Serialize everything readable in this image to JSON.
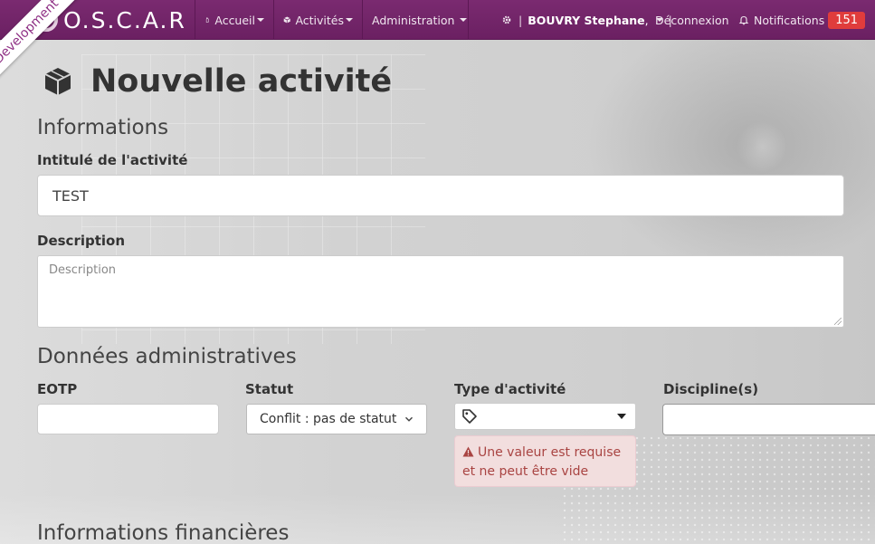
{
  "ribbon": {
    "text": "Development"
  },
  "navbar": {
    "brand": "O.S.C.A.R",
    "menus": [
      {
        "label": "Accueil",
        "icon": "hand-icon"
      },
      {
        "label": "Activités",
        "icon": "cube-icon"
      },
      {
        "label": "Administration",
        "icon": ""
      }
    ],
    "user": {
      "name": "BOUVRY Stephane",
      "suffix": ","
    },
    "logout": "Déconnexion",
    "notifications": {
      "label": "Notifications",
      "count": "151"
    },
    "colors": {
      "bar": "#6b2062",
      "badge": "#e03c3c"
    }
  },
  "page": {
    "title": "Nouvelle activité",
    "title_icon": "cube-icon"
  },
  "informations": {
    "heading": "Informations",
    "intitule_label": "Intitulé de l'activité",
    "intitule_value": "TEST",
    "description_label": "Description",
    "description_placeholder": "Description"
  },
  "admin": {
    "heading": "Données administratives",
    "eotp_label": "EOTP",
    "eotp_value": "",
    "statut_label": "Statut",
    "statut_value": "Conflit : pas de statut",
    "type_label": "Type d'activité",
    "type_value": "",
    "type_icon": "tag-icon",
    "type_error": "Une valeur est requise et ne peut être vide",
    "discipline_label": "Discipline(s)",
    "discipline_value": ""
  },
  "financial": {
    "heading": "Informations financières"
  }
}
